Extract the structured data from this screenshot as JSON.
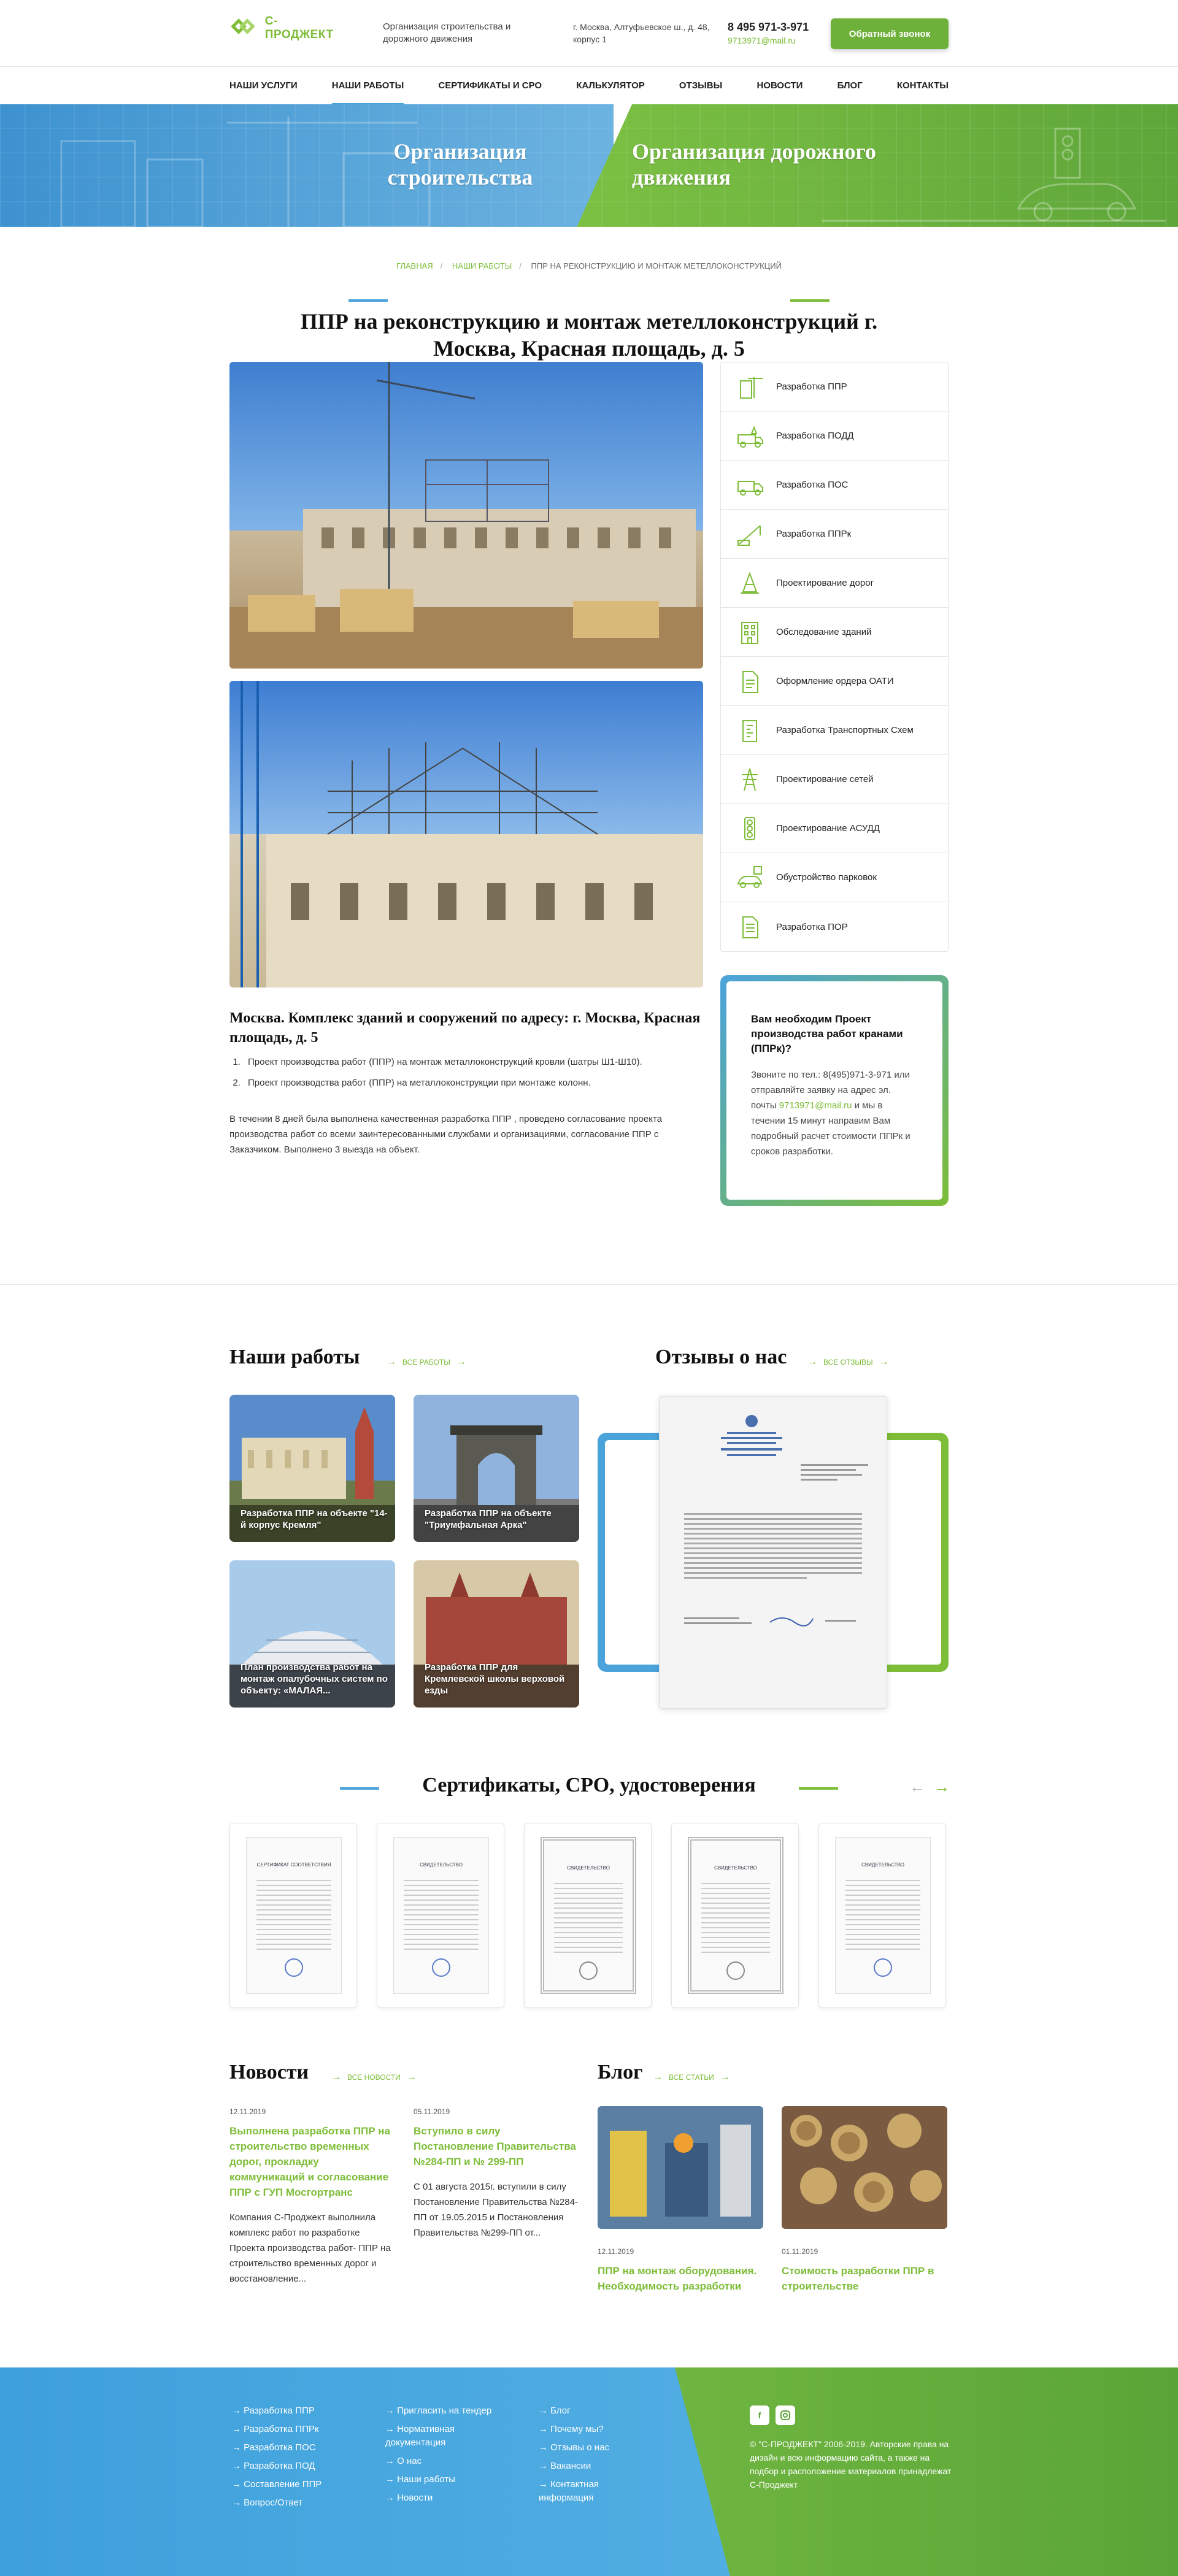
{
  "header": {
    "logo_text": "С-ПРОДЖЕКТ",
    "tagline": "Организация строительства и дорожного движения",
    "address": "г. Москва, Алтуфьевское ш., д. 48, корпус 1",
    "phone": "8 495 971-3-971",
    "email": "9713971@mail.ru",
    "callback_button": "Обратный звонок"
  },
  "nav": [
    {
      "label": "Наши услуги"
    },
    {
      "label": "Наши работы"
    },
    {
      "label": "Сертификаты и СРО"
    },
    {
      "label": "Калькулятор"
    },
    {
      "label": "Отзывы"
    },
    {
      "label": "Новости"
    },
    {
      "label": "Блог"
    },
    {
      "label": "Контакты"
    }
  ],
  "banner": {
    "left_title": "Организация строительства",
    "right_title": "Организация дорожного движения"
  },
  "breadcrumbs": {
    "home": "ГЛАВНАЯ",
    "works": "НАШИ РАБОТЫ",
    "current": "ППР НА РЕКОНСТРУКЦИЮ И МОНТАЖ МЕТЕЛЛОКОНСТРУКЦИЙ"
  },
  "page_title": "ППР на реконструкцию и монтаж метеллоконструкций г. Москва, Красная площадь, д. 5",
  "services": [
    {
      "label": "Разработка ППР",
      "icon": "building-crane-icon"
    },
    {
      "label": "Разработка ПОДД",
      "icon": "roadwork-truck-icon"
    },
    {
      "label": "Разработка ПОС",
      "icon": "truck-icon"
    },
    {
      "label": "Разработка ППРк",
      "icon": "crane-icon"
    },
    {
      "label": "Проектирование дорог",
      "icon": "road-cone-icon"
    },
    {
      "label": "Обследование зданий",
      "icon": "building-icon"
    },
    {
      "label": "Оформление ордера ОАТИ",
      "icon": "document-icon"
    },
    {
      "label": "Разработка Транспортных Схем",
      "icon": "transport-scheme-icon"
    },
    {
      "label": "Проектирование сетей",
      "icon": "power-tower-icon"
    },
    {
      "label": "Проектирование АСУДД",
      "icon": "traffic-light-icon"
    },
    {
      "label": "Обустройство парковок",
      "icon": "parking-car-icon"
    },
    {
      "label": "Разработка ПОР",
      "icon": "document-list-icon"
    }
  ],
  "project": {
    "subtitle": "Москва. Комплекс зданий и сооружений по адресу: г. Москва, Красная площадь, д. 5",
    "items": [
      "Проект производства работ (ППР) на монтаж металлоконструкций кровли (шатры Ш1-Ш10).",
      "Проект производства работ (ППР) на металлоконструкции при монтаже колонн."
    ],
    "description": "В течении 8 дней была выполнена качественная разработка ППР , проведено согласование проекта производства работ со всеми заинтересованными службами и организациями, согласование ППР с Заказчиком. Выполнено 3 выезда на объект."
  },
  "cta_box": {
    "title": "Вам необходим Проект производства работ кранами (ППРк)?",
    "text_before": "Звоните по тел.: 8(495)971-3-971 или отправляйте заявку на адрес эл. почты",
    "email": "9713971@mail.ru",
    "text_after": "и мы в течении 15 минут направим Вам подробный расчет стоимости ППРк и сроков разработки."
  },
  "our_works": {
    "title": "Наши работы",
    "link": "ВСЕ РАБОТЫ",
    "cards": [
      "Разработка ППР на объекте \"14-й корпус Кремля\"",
      "Разработка ППР на объекте \"Триумфальная Арка\"",
      "План производства работ на монтаж опалубочных систем по объекту: «МАЛАЯ...",
      "Разработка ППР для Кремлевской школы верховой езды"
    ]
  },
  "reviews": {
    "title": "Отзывы о нас",
    "link": "ВСЕ ОТЗЫВЫ"
  },
  "certificates": {
    "title": "Сертификаты, СРО, удостоверения",
    "items": [
      "СЕРТИФИКАТ СООТВЕТСТВИЯ",
      "СВИДЕТЕЛЬСТВО",
      "СВИДЕТЕЛЬСТВО",
      "СВИДЕТЕЛЬСТВО",
      "СВИДЕТЕЛЬСТВО",
      "СЕРТИФИКАТ СООТВЕТСТВИЯ"
    ]
  },
  "news": {
    "title": "Новости",
    "link": "ВСЕ НОВОСТИ",
    "items": [
      {
        "date": "12.11.2019",
        "title": "Выполнена разработка ППР на строительство временных дорог, прокладку коммуникаций и согласование ППР с ГУП Мосгортранс",
        "text": "Компания С-Проджект выполнила комплекс работ по разработке Проекта производства работ- ППР на строительство временных дорог и восстановление..."
      },
      {
        "date": "05.11.2019",
        "title": "Вступило в силу Постановление Правительства №284-ПП и № 299-ПП",
        "text": "С 01 августа 2015г. вступили в силу Постановление Правительства №284-ПП от 19.05.2015 и Постановления Правительства №299-ПП от..."
      }
    ]
  },
  "blog": {
    "title": "Блог",
    "link": "ВСЕ СТАТЬИ",
    "items": [
      {
        "date": "12.11.2019",
        "title": "ППР на монтаж оборудования. Необходимость разработки"
      },
      {
        "date": "01.11.2019",
        "title": "Стоимость разработки ППР в строительстве"
      }
    ]
  },
  "footer": {
    "col1": [
      "Разработка ППР",
      "Разработка ППРк",
      "Разработка ПОС",
      "Разработка ПОД",
      "Составление ППР",
      "Вопрос/Ответ"
    ],
    "col2": [
      "Пригласить на тендер",
      "Нормативная документация",
      "О нас",
      "Наши работы",
      "Новости"
    ],
    "col3": [
      "Блог",
      "Почему мы?",
      "Отзывы о нас",
      "Вакансии",
      "Контактная информация"
    ],
    "copyright": "© \"С-ПРОДЖЕКТ\" 2006-2019. Авторские права на дизайн и всю информацию сайта, а также на подбор и расположение материалов принадлежат С-Проджект"
  }
}
